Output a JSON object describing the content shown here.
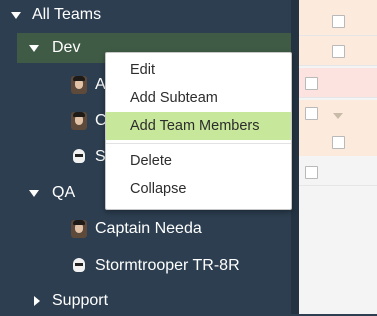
{
  "tree": {
    "root": {
      "label": "All Teams",
      "expanded": true
    },
    "teams": [
      {
        "label": "Dev",
        "expanded": true,
        "selected": true,
        "members": [
          {
            "label": "Ad",
            "avatar": "human-avatar-icon"
          },
          {
            "label": "C",
            "avatar": "human-avatar-icon"
          },
          {
            "label": "St",
            "avatar": "stormtrooper-avatar-icon"
          }
        ]
      },
      {
        "label": "QA",
        "expanded": true,
        "selected": false,
        "members": [
          {
            "label": "Captain Needa",
            "avatar": "human-avatar-icon"
          },
          {
            "label": "Stormtrooper TR-8R",
            "avatar": "stormtrooper-avatar-icon"
          }
        ]
      },
      {
        "label": "Support",
        "expanded": false,
        "selected": false,
        "members": []
      }
    ]
  },
  "context_menu": {
    "items": [
      {
        "label": "Edit",
        "hovered": false
      },
      {
        "label": "Add Subteam",
        "hovered": false
      },
      {
        "label": "Add Team Members",
        "hovered": true
      }
    ],
    "items_after_separator": [
      {
        "label": "Delete",
        "hovered": false
      },
      {
        "label": "Collapse",
        "hovered": false
      }
    ]
  },
  "colors": {
    "sidebar_bg": "#2c3e50",
    "selected_row_bg": "#3f5b45",
    "menu_hover": "#c7e79a",
    "row_highlight_red": "#fce3e0",
    "row_highlight_orange": "#fcebdd"
  }
}
